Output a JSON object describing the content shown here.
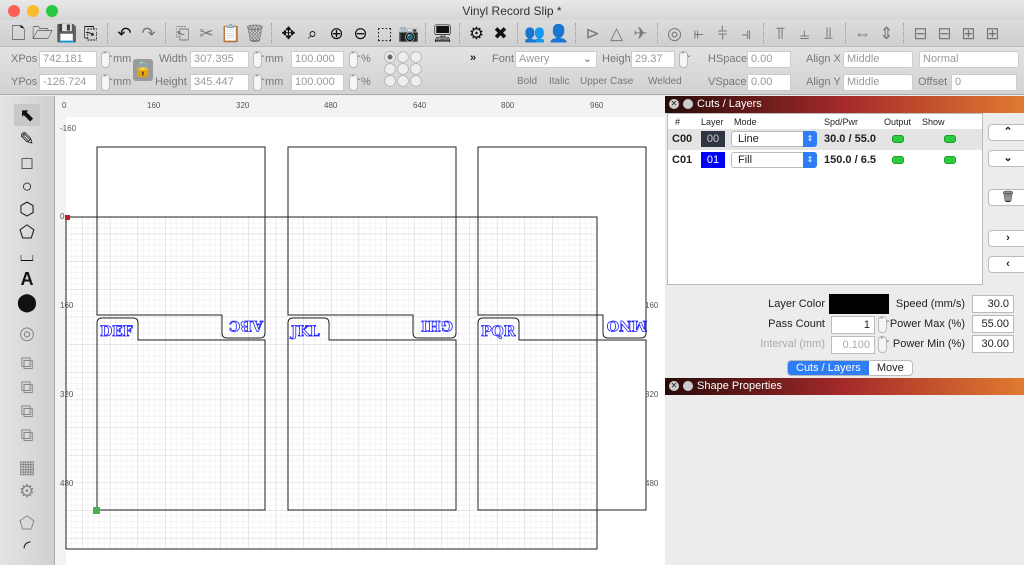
{
  "window": {
    "title": "Vinyl Record Slip *"
  },
  "toolbar": {
    "icons": [
      "new-file",
      "open",
      "save",
      "export",
      "undo",
      "redo",
      "copy",
      "cut",
      "paste",
      "delete",
      "move",
      "zoom-page",
      "zoom-in",
      "zoom-out",
      "select-frame",
      "camera",
      "device",
      "settings",
      "tools",
      "group",
      "ungroup",
      "mirror-h",
      "mirror-v",
      "rotate",
      "center",
      "align-left",
      "align-hcenter",
      "align-right",
      "align-top",
      "align-vcenter",
      "align-bottom",
      "distribute-h",
      "distribute-v",
      "dock-1",
      "dock-2",
      "dock-3",
      "dock-4"
    ]
  },
  "props": {
    "xpos_label": "XPos",
    "xpos": "742.181",
    "ypos_label": "YPos",
    "ypos": "-126.724",
    "unit": "mm",
    "width_label": "Width",
    "width": "307.395",
    "height_label": "Height",
    "height": "345.447",
    "scale_x": "100.000",
    "scale_y": "100.000",
    "pct": "%",
    "more": "»",
    "font_label": "Font",
    "font": "Awery",
    "text_height_label": "Height",
    "text_height": "29.37",
    "hspace_label": "HSpace",
    "hspace": "0.00",
    "vspace_label": "VSpace",
    "vspace": "0.00",
    "alignx_label": "Align X",
    "alignx": "Middle",
    "aligny_label": "Align Y",
    "aligny": "Middle",
    "mode": "Normal",
    "offset_label": "Offset",
    "offset": "0",
    "bold": "Bold",
    "italic": "Italic",
    "upper": "Upper Case",
    "welded": "Welded"
  },
  "rulers": {
    "top": [
      "0",
      "160",
      "320",
      "480",
      "640",
      "800",
      "960"
    ],
    "left": [
      "-160",
      "0",
      "160",
      "320",
      "480"
    ],
    "right": [
      "160",
      "320",
      "480"
    ]
  },
  "canvas": {
    "labels_front": [
      "DEF",
      "JKL",
      "PQR"
    ],
    "labels_back": [
      "ABC",
      "GHI",
      "MNO"
    ],
    "text_color": "#2222ff"
  },
  "cuts": {
    "title": "Cuts / Layers",
    "headers": [
      "#",
      "Layer",
      "Mode",
      "Spd/Pwr",
      "Output",
      "Show"
    ],
    "rows": [
      {
        "id": "C00",
        "layer": "00",
        "color": "#2f3542",
        "mode": "Line",
        "spdpwr": "30.0 / 55.0",
        "output": true,
        "show": true
      },
      {
        "id": "C01",
        "layer": "01",
        "color": "#0000ff",
        "mode": "Fill",
        "spdpwr": "150.0 / 6.5",
        "output": true,
        "show": true
      }
    ],
    "layer_color_label": "Layer Color",
    "layer_color": "#000000",
    "pass_count_label": "Pass Count",
    "pass_count": "1",
    "interval_label": "Interval (mm)",
    "interval": "0.100",
    "speed_label": "Speed (mm/s)",
    "speed": "30.0",
    "power_max_label": "Power Max (%)",
    "power_max": "55.00",
    "power_min_label": "Power Min (%)",
    "power_min": "30.00",
    "tab_cuts": "Cuts / Layers",
    "tab_move": "Move"
  },
  "shape": {
    "title": "Shape Properties"
  }
}
